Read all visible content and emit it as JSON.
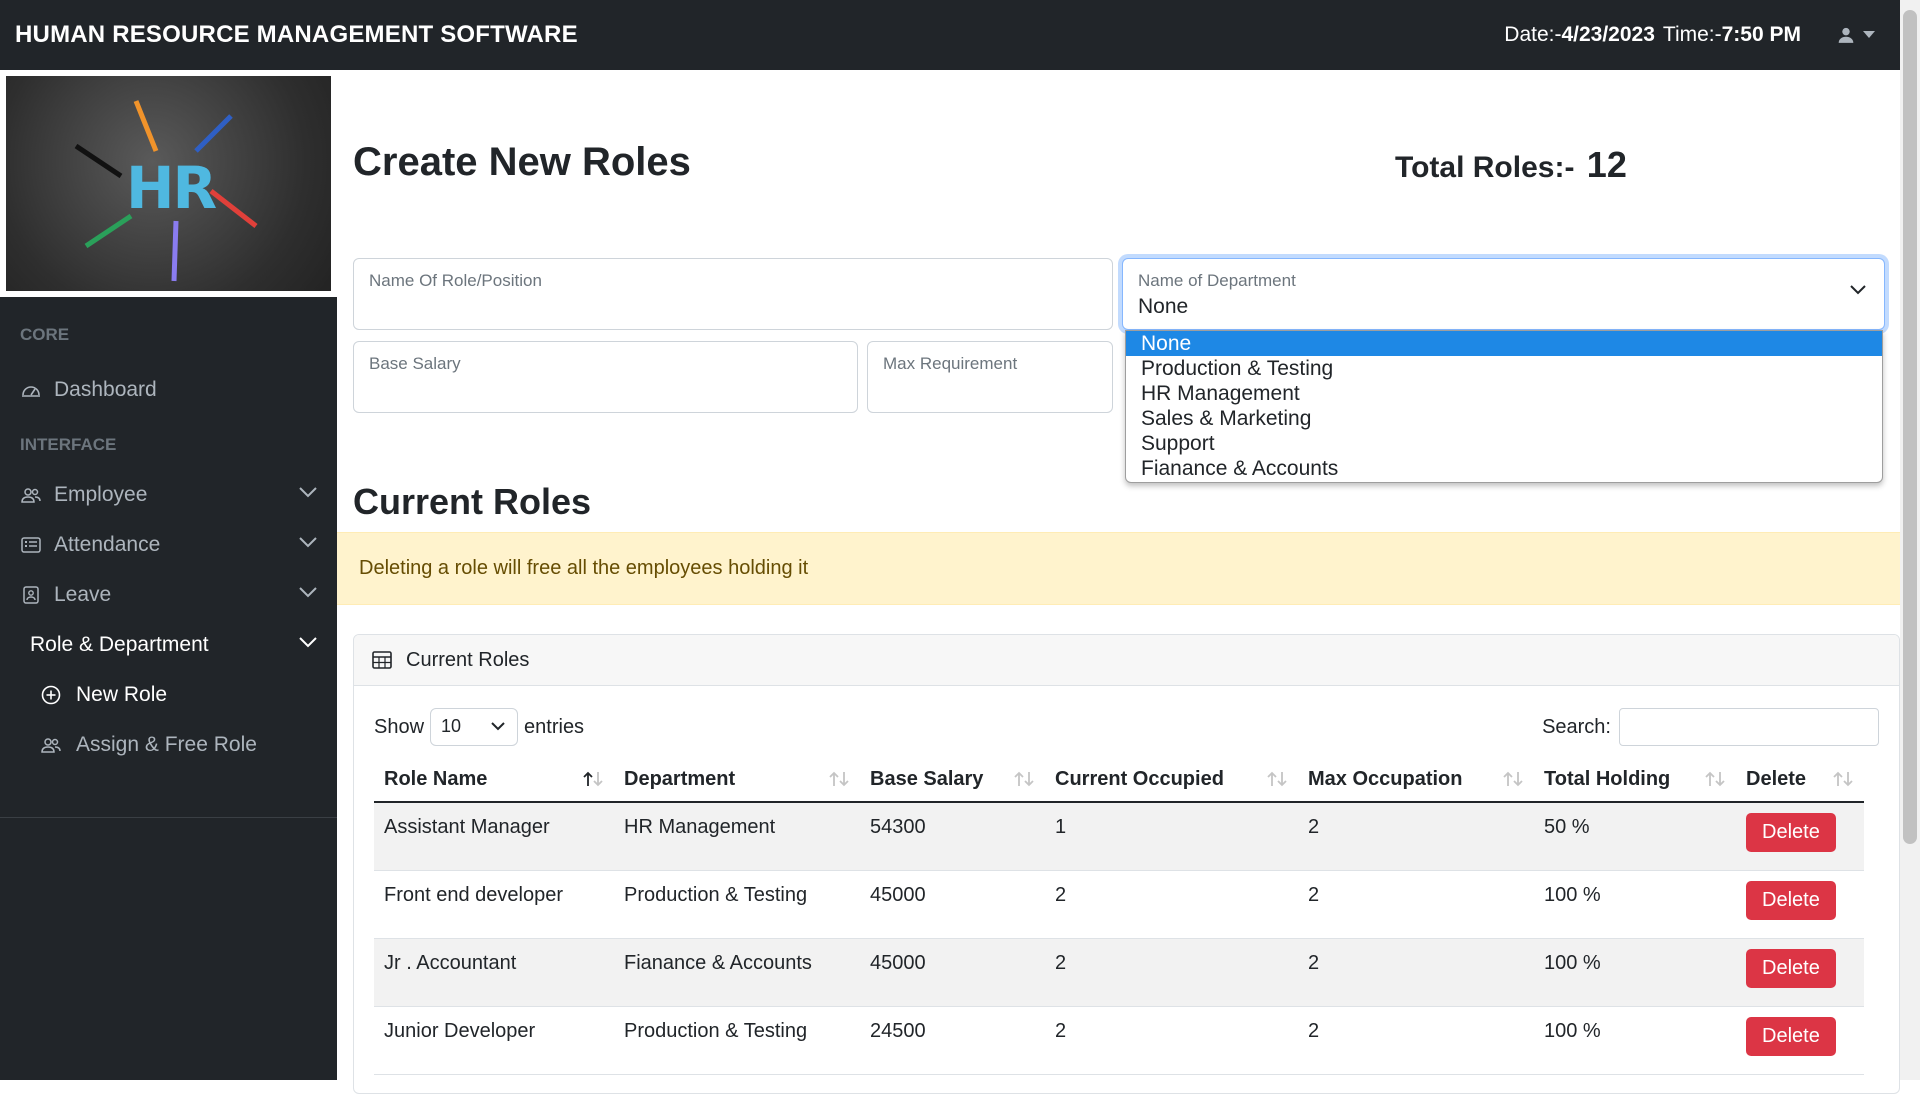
{
  "header": {
    "title": "HUMAN RESOURCE MANAGEMENT SOFTWARE",
    "date_label": "Date:-",
    "date_value": "4/23/2023",
    "time_label": "Time:-",
    "time_value": "7:50 PM"
  },
  "sidebar": {
    "logo_text": "HR",
    "core_heading": "CORE",
    "dashboard": "Dashboard",
    "interface_heading": "INTERFACE",
    "employee": "Employee",
    "attendance": "Attendance",
    "leave": "Leave",
    "role_department": "Role & Department",
    "new_role": "New Role",
    "assign_free_role": "Assign & Free Role"
  },
  "main": {
    "page_title": "Create New Roles",
    "total_roles_label": "Total Roles:-",
    "total_roles_value": "12",
    "form": {
      "role_name_label": "Name Of Role/Position",
      "department_label": "Name of Department",
      "department_value": "None",
      "base_salary_label": "Base Salary",
      "max_requirement_label": "Max Requirement"
    },
    "department_options": [
      "None",
      "Production & Testing",
      "HR Management",
      "Sales & Marketing",
      "Support",
      "Fianance & Accounts"
    ],
    "current_roles_title": "Current Roles",
    "alert_text": "Deleting a role will free all the employees holding it",
    "card_title": "Current Roles",
    "show_label": "Show",
    "entries_value": "10",
    "entries_label": "entries",
    "search_label": "Search:"
  },
  "table": {
    "columns": [
      "Role Name",
      "Department",
      "Base Salary",
      "Current Occupied",
      "Max Occupation",
      "Total Holding",
      "Delete"
    ],
    "rows": [
      {
        "role": "Assistant Manager",
        "department": "HR Management",
        "salary": "54300",
        "occupied": "1",
        "max": "2",
        "holding": "50 %",
        "action": "Delete"
      },
      {
        "role": "Front end developer",
        "department": "Production & Testing",
        "salary": "45000",
        "occupied": "2",
        "max": "2",
        "holding": "100 %",
        "action": "Delete"
      },
      {
        "role": "Jr . Accountant",
        "department": "Fianance & Accounts",
        "salary": "45000",
        "occupied": "2",
        "max": "2",
        "holding": "100 %",
        "action": "Delete"
      },
      {
        "role": "Junior Developer",
        "department": "Production & Testing",
        "salary": "24500",
        "occupied": "2",
        "max": "2",
        "holding": "100 %",
        "action": "Delete"
      }
    ]
  },
  "colors": {
    "topbar": "#212529",
    "sidebar": "#212529",
    "delete_button": "#dc3545",
    "alert_bg": "#fff3cd",
    "selected_option": "#1e88e5"
  }
}
